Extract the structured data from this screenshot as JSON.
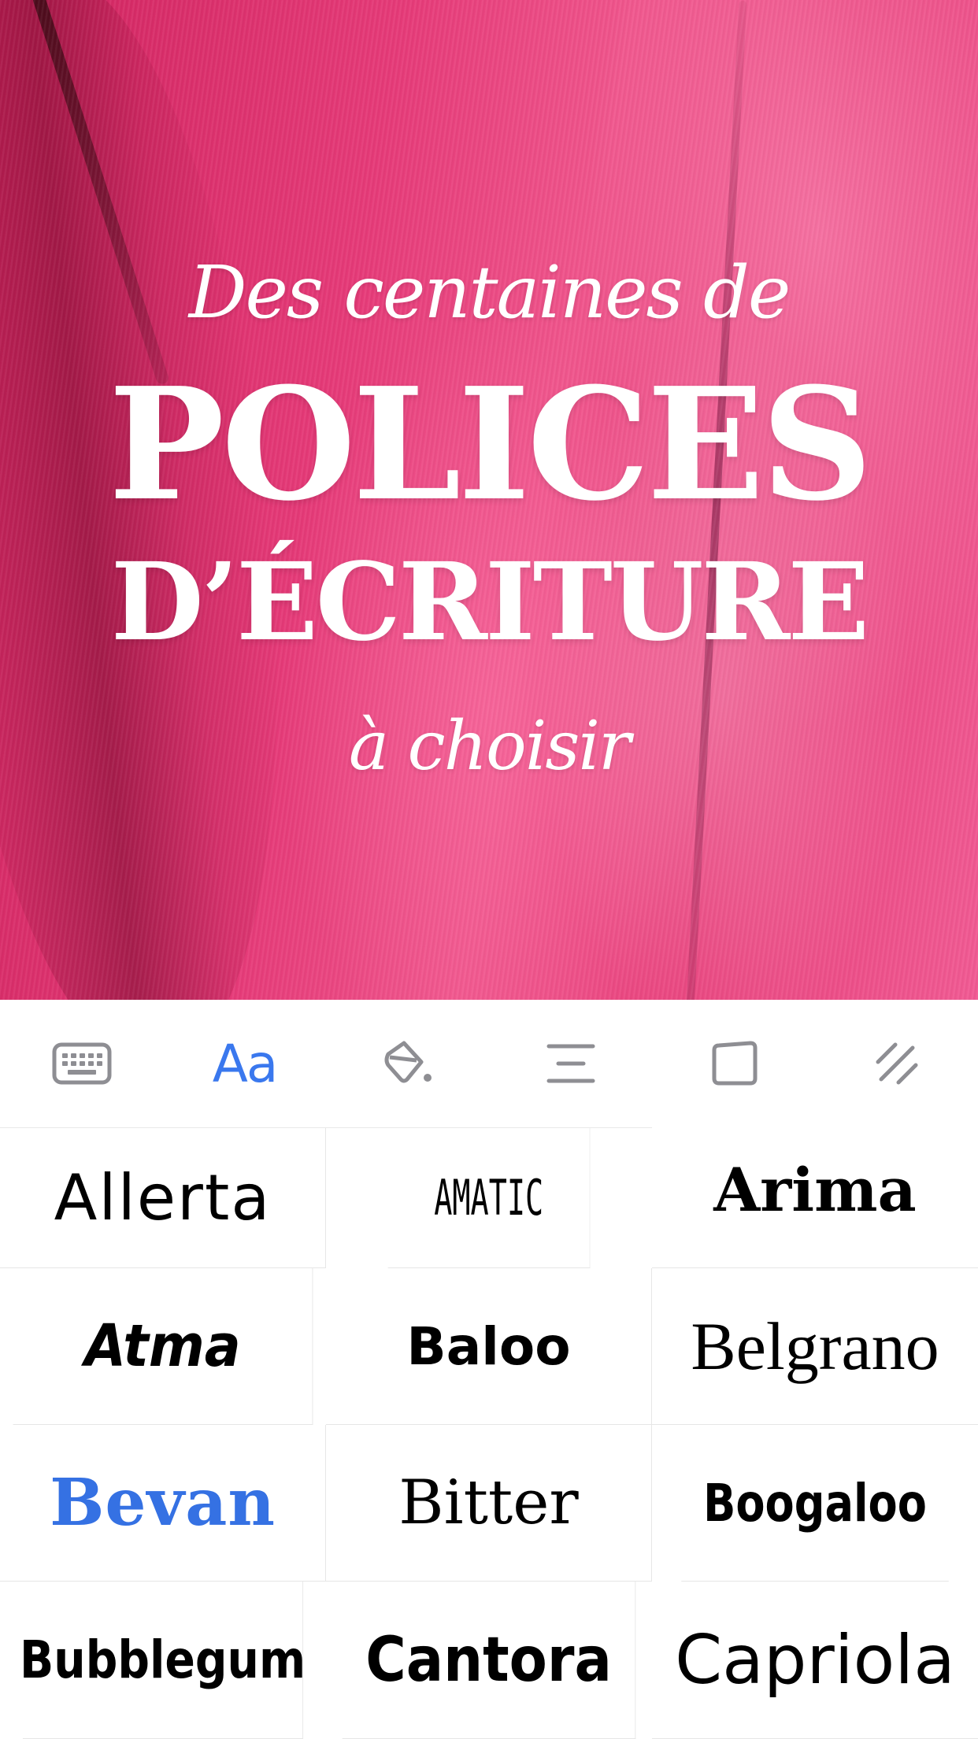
{
  "hero": {
    "line1": "Des centaines de",
    "line2": "POLICES",
    "line3": "D’ÉCRITURE",
    "line4": "à choisir"
  },
  "toolbar": {
    "items": [
      {
        "icon": "keyboard-icon",
        "active": false
      },
      {
        "icon": "font-icon",
        "label": "Aa",
        "active": true
      },
      {
        "icon": "paint-bucket-icon",
        "active": false
      },
      {
        "icon": "text-align-icon",
        "active": false
      },
      {
        "icon": "shape-icon",
        "active": false
      },
      {
        "icon": "texture-icon",
        "active": false
      }
    ],
    "active_color": "#3a78ee",
    "inactive_color": "#8e8e93"
  },
  "fonts": [
    {
      "label": "Allerta",
      "selected": false
    },
    {
      "label": "AMATIC",
      "selected": false
    },
    {
      "label": "Arima",
      "selected": false
    },
    {
      "label": "Atma",
      "selected": false
    },
    {
      "label": "Baloo",
      "selected": false
    },
    {
      "label": "Belgrano",
      "selected": false
    },
    {
      "label": "Bevan",
      "selected": true
    },
    {
      "label": "Bitter",
      "selected": false
    },
    {
      "label": "Boogaloo",
      "selected": false
    },
    {
      "label": "Bubblegum",
      "selected": false
    },
    {
      "label": "Cantora",
      "selected": false
    },
    {
      "label": "Capriola",
      "selected": false
    }
  ],
  "colors": {
    "selected_font": "#3571e3",
    "hero_pink": "#e63a78"
  }
}
